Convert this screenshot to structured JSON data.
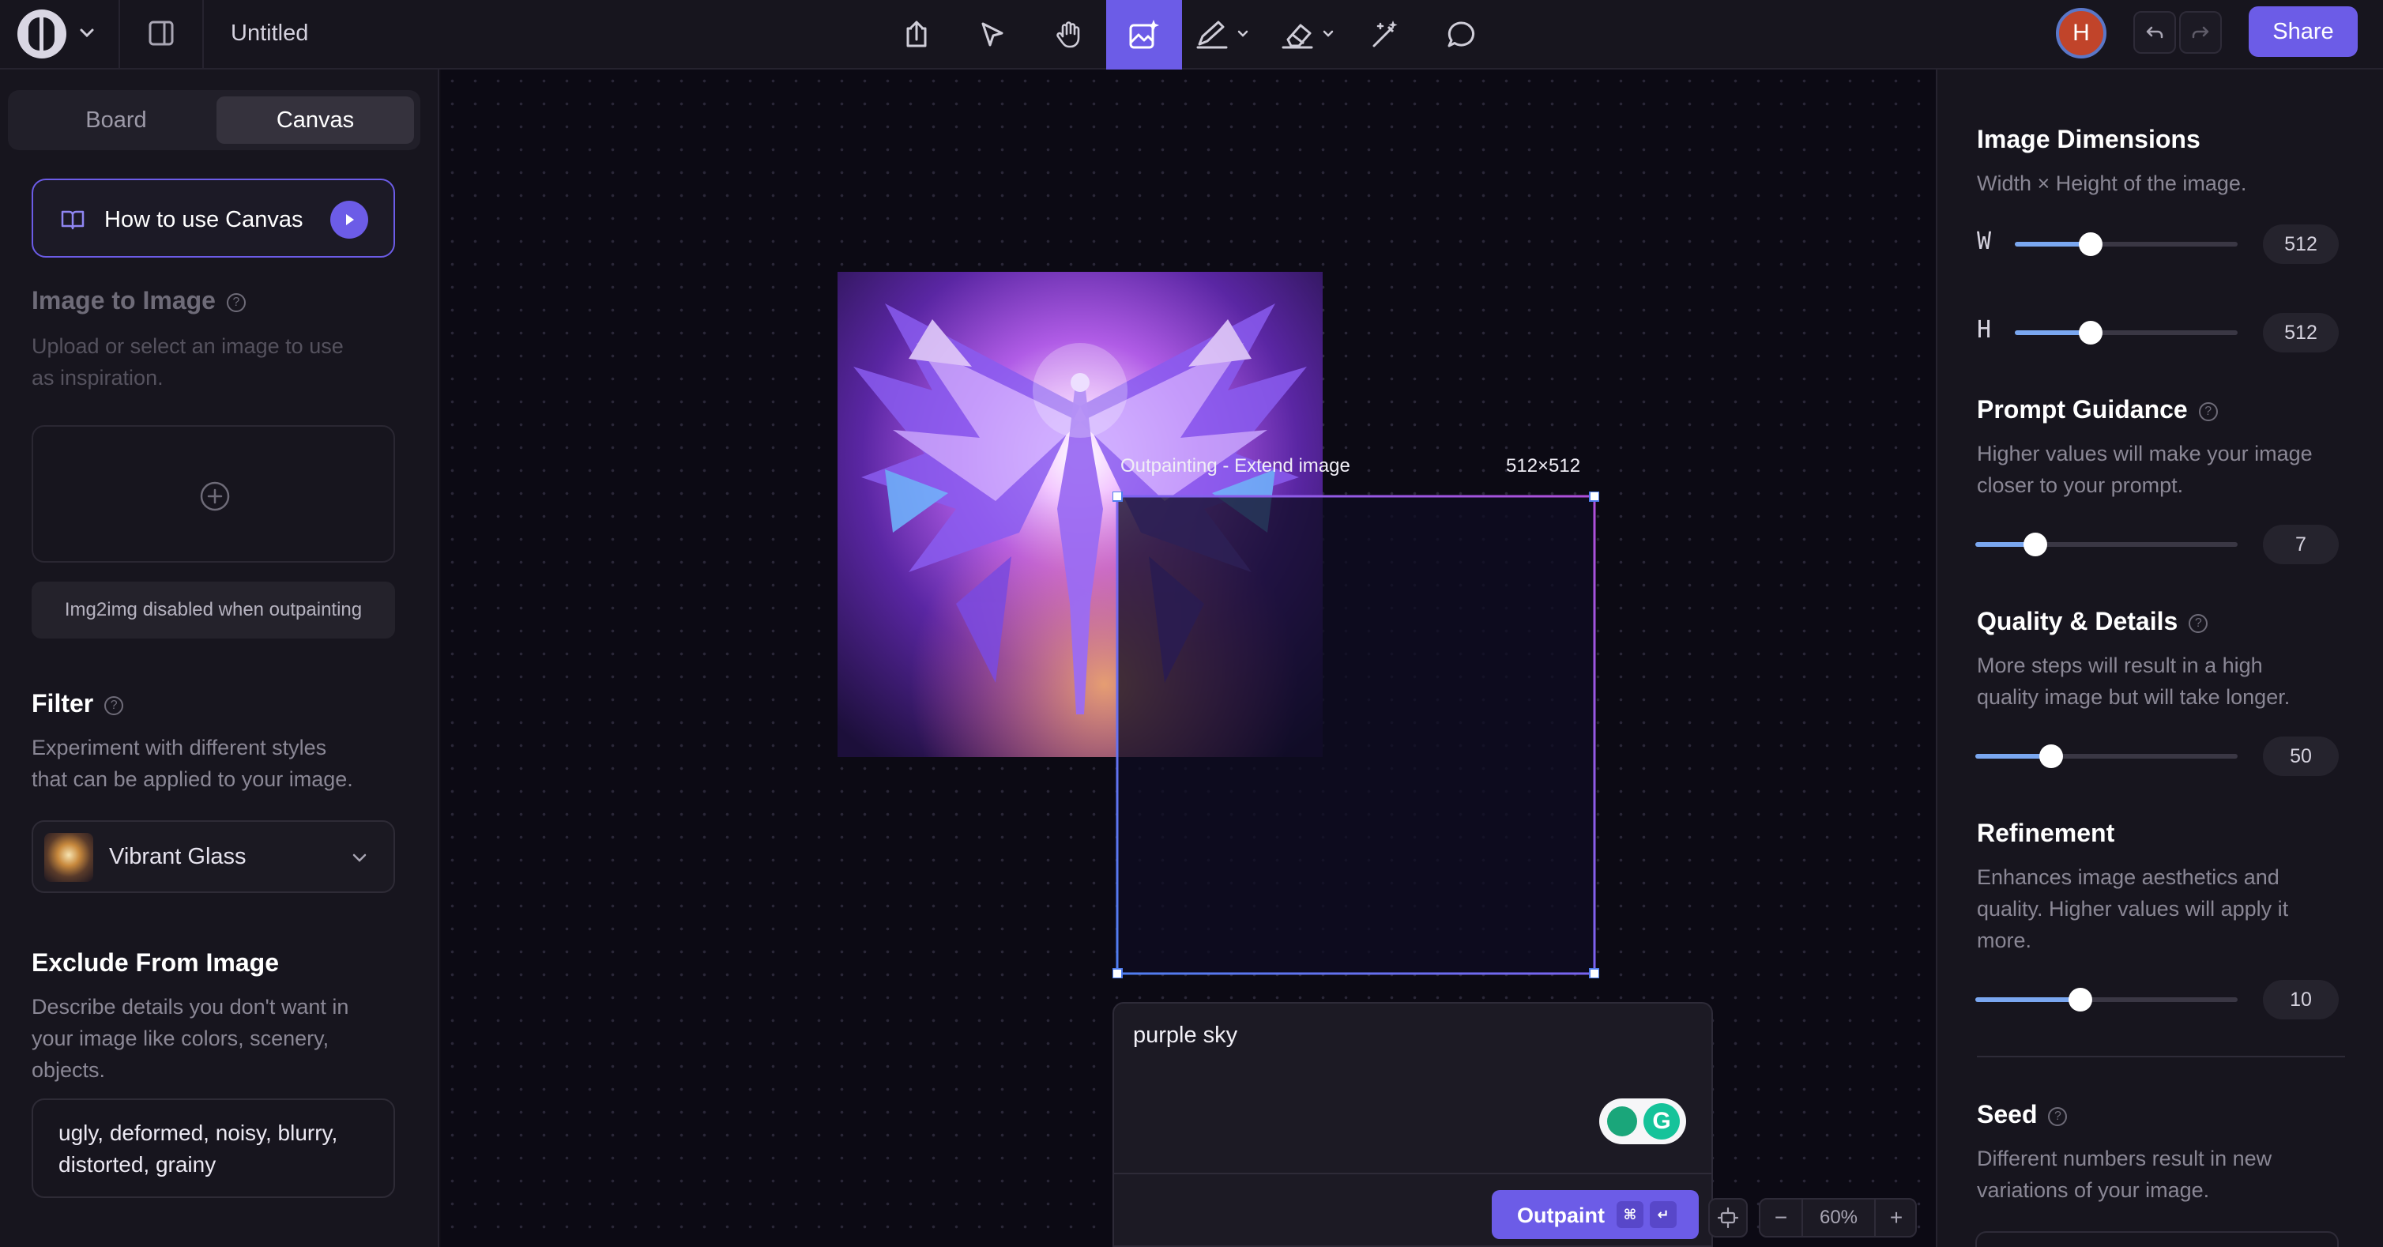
{
  "header": {
    "title": "Untitled",
    "share_label": "Share",
    "avatar_initial": "H",
    "active_tool": "outpaint-tool"
  },
  "left": {
    "tabs": [
      {
        "label": "Board",
        "active": false
      },
      {
        "label": "Canvas",
        "active": true
      }
    ],
    "howto_label": "How to use Canvas",
    "img2img": {
      "title": "Image to Image",
      "desc_line1": "Upload or select an image to use",
      "desc_line2": "as inspiration.",
      "disabled_note": "Img2img disabled when outpainting"
    },
    "filter": {
      "title": "Filter",
      "desc_line1": "Experiment with different styles",
      "desc_line2": "that can be applied to your image.",
      "selected": "Vibrant Glass"
    },
    "exclude": {
      "title": "Exclude From Image",
      "desc_line1": "Describe details you don't want in",
      "desc_line2": "your image like colors, scenery,",
      "desc_line3": "objects.",
      "value": "ugly, deformed, noisy, blurry, distorted, grainy"
    }
  },
  "canvas": {
    "outpaint_label": "Outpainting - Extend image",
    "outpaint_size": "512×512",
    "prompt_value": "purple sky",
    "outpaint_button": "Outpaint",
    "shortcut_cmd": "⌘",
    "shortcut_enter": "↵",
    "zoom": {
      "minus": "−",
      "value": "60%",
      "plus": "+"
    }
  },
  "right": {
    "dimensions": {
      "title": "Image Dimensions",
      "desc": "Width × Height of the image.",
      "width_label": "W",
      "height_label": "H",
      "width_value": "512",
      "height_value": "512",
      "width_fraction": 0.34,
      "height_fraction": 0.34
    },
    "guidance": {
      "title": "Prompt Guidance",
      "desc_line1": "Higher values will make your image",
      "desc_line2": "closer to your prompt.",
      "value": "7",
      "fraction": 0.23
    },
    "quality": {
      "title": "Quality & Details",
      "desc_line1": "More steps will result in a high",
      "desc_line2": "quality image but will take longer.",
      "value": "50",
      "fraction": 0.29
    },
    "refinement": {
      "title": "Refinement",
      "desc_line1": "Enhances image aesthetics and",
      "desc_line2": "quality. Higher values will apply it",
      "desc_line3": "more.",
      "value": "10",
      "fraction": 0.4
    },
    "seed": {
      "title": "Seed",
      "desc_line1": "Different numbers result in new",
      "desc_line2": "variations of your image."
    }
  },
  "colors": {
    "accent": "#6c5ce7",
    "slider_fill": "#7aa7f0",
    "background": "#0f0d16"
  }
}
